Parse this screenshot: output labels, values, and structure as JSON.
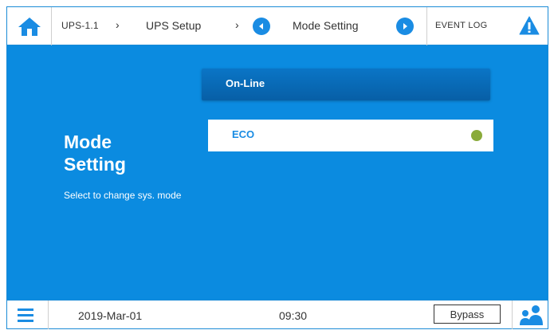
{
  "header": {
    "breadcrumb_1": "UPS-1.1",
    "sep_1": "›",
    "breadcrumb_2": "UPS Setup",
    "sep_2": "›",
    "breadcrumb_3": "Mode Setting",
    "event_log": "EVENT LOG"
  },
  "panel": {
    "title": "Mode Setting",
    "hint": "Select to change sys. mode"
  },
  "options": [
    {
      "label": "On-Line",
      "selected": false
    },
    {
      "label": "ECO",
      "selected": true,
      "indicator_color": "#8aab3a"
    }
  ],
  "footer": {
    "date": "2019-Mar-01",
    "time": "09:30",
    "bypass_label": "Bypass"
  },
  "colors": {
    "accent": "#0b8be0",
    "option_selected_bg": "#ffffff",
    "option_bg": "#0a6cbb"
  },
  "icons": [
    "home-icon",
    "prev-arrow-icon",
    "next-arrow-icon",
    "alert-icon",
    "menu-icon",
    "users-icon"
  ]
}
